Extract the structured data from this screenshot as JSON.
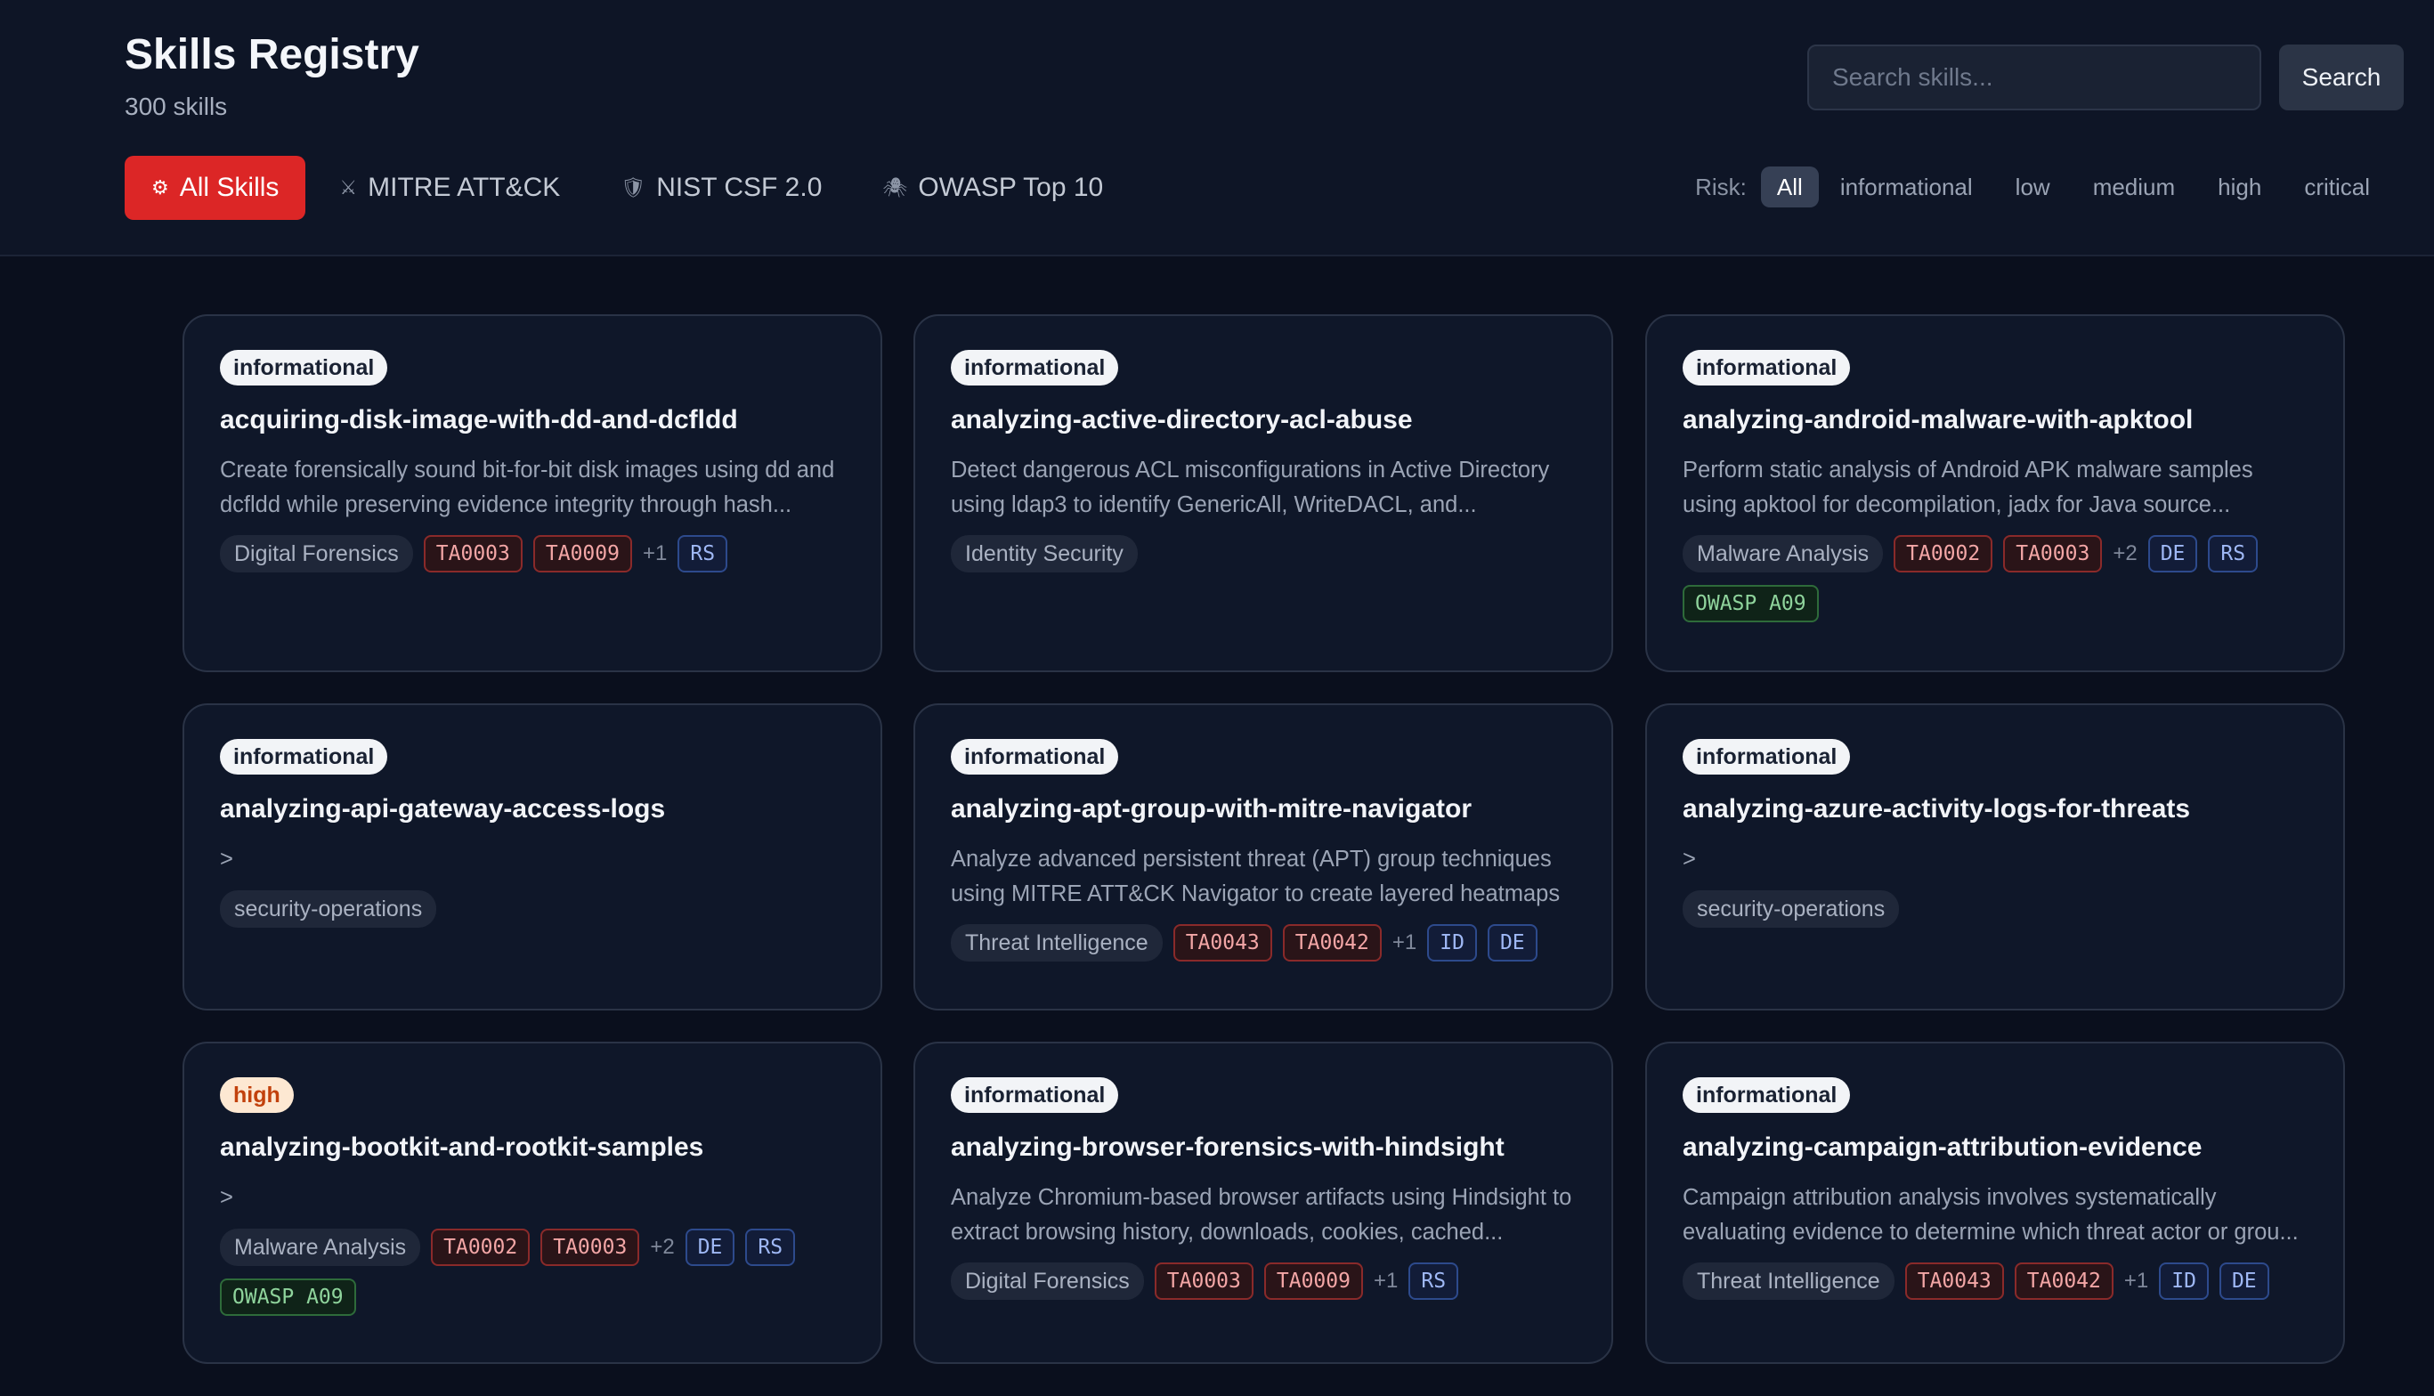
{
  "header": {
    "title": "Skills Registry",
    "count": "300 skills",
    "search_placeholder": "Search skills...",
    "search_button": "Search"
  },
  "frameworks": [
    {
      "label": "All Skills",
      "icon": "gear-icon",
      "glyph": "⚙"
    },
    {
      "label": "MITRE ATT&CK",
      "icon": "swords-icon",
      "glyph": "⚔"
    },
    {
      "label": "NIST CSF 2.0",
      "icon": "shield-icon",
      "glyph": "🛡"
    },
    {
      "label": "OWASP Top 10",
      "icon": "spider-icon",
      "glyph": "🕷"
    }
  ],
  "risk_filter": {
    "label": "Risk:",
    "options": [
      "All",
      "informational",
      "low",
      "medium",
      "high",
      "critical"
    ],
    "selected": "All"
  },
  "colors": {
    "accent": "#dc2626",
    "background": "#0a0f1d",
    "card": "#0f1729"
  },
  "cards": [
    {
      "risk": "informational",
      "title": "acquiring-disk-image-with-dd-and-dcfldd",
      "desc": "Create forensically sound bit-for-bit disk images using dd and dcfldd while preserving evidence integrity through hash...",
      "domain": "Digital Forensics",
      "mitre": [
        "TA0003",
        "TA0009"
      ],
      "mitre_more": "+1",
      "nist": [
        "RS"
      ],
      "owasp": []
    },
    {
      "risk": "informational",
      "title": "analyzing-active-directory-acl-abuse",
      "desc": "Detect dangerous ACL misconfigurations in Active Directory using ldap3 to identify GenericAll, WriteDACL, and...",
      "domain": "Identity Security",
      "mitre": [],
      "mitre_more": "",
      "nist": [],
      "owasp": []
    },
    {
      "risk": "informational",
      "title": "analyzing-android-malware-with-apktool",
      "desc": "Perform static analysis of Android APK malware samples using apktool for decompilation, jadx for Java source...",
      "domain": "Malware Analysis",
      "mitre": [
        "TA0002",
        "TA0003"
      ],
      "mitre_more": "+2",
      "nist": [
        "DE",
        "RS"
      ],
      "owasp": [
        "OWASP A09"
      ]
    },
    {
      "risk": "informational",
      "title": "analyzing-api-gateway-access-logs",
      "desc": ">",
      "domain": "security-operations",
      "mitre": [],
      "mitre_more": "",
      "nist": [],
      "owasp": []
    },
    {
      "risk": "informational",
      "title": "analyzing-apt-group-with-mitre-navigator",
      "desc": "Analyze advanced persistent threat (APT) group techniques using MITRE ATT&CK Navigator to create layered heatmaps ...",
      "domain": "Threat Intelligence",
      "mitre": [
        "TA0043",
        "TA0042"
      ],
      "mitre_more": "+1",
      "nist": [
        "ID",
        "DE"
      ],
      "owasp": []
    },
    {
      "risk": "informational",
      "title": "analyzing-azure-activity-logs-for-threats",
      "desc": ">",
      "domain": "security-operations",
      "mitre": [],
      "mitre_more": "",
      "nist": [],
      "owasp": []
    },
    {
      "risk": "high",
      "title": "analyzing-bootkit-and-rootkit-samples",
      "desc": ">",
      "domain": "Malware Analysis",
      "mitre": [
        "TA0002",
        "TA0003"
      ],
      "mitre_more": "+2",
      "nist": [
        "DE",
        "RS"
      ],
      "owasp": [
        "OWASP A09"
      ]
    },
    {
      "risk": "informational",
      "title": "analyzing-browser-forensics-with-hindsight",
      "desc": "Analyze Chromium-based browser artifacts using Hindsight to extract browsing history, downloads, cookies, cached...",
      "domain": "Digital Forensics",
      "mitre": [
        "TA0003",
        "TA0009"
      ],
      "mitre_more": "+1",
      "nist": [
        "RS"
      ],
      "owasp": []
    },
    {
      "risk": "informational",
      "title": "analyzing-campaign-attribution-evidence",
      "desc": "Campaign attribution analysis involves systematically evaluating evidence to determine which threat actor or grou...",
      "domain": "Threat Intelligence",
      "mitre": [
        "TA0043",
        "TA0042"
      ],
      "mitre_more": "+1",
      "nist": [
        "ID",
        "DE"
      ],
      "owasp": []
    }
  ]
}
